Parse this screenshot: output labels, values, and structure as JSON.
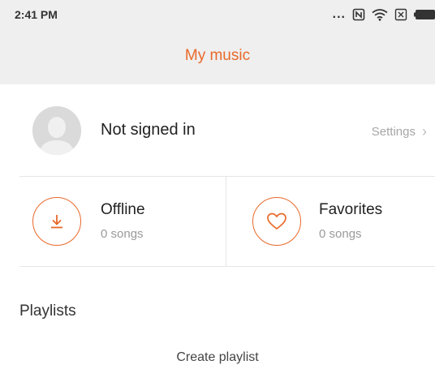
{
  "status_bar": {
    "time": "2:41 PM",
    "icons": [
      "more-dots-icon",
      "nfc-icon",
      "wifi-icon",
      "sim-icon",
      "battery-icon"
    ],
    "dots": "..."
  },
  "header": {
    "title": "My music"
  },
  "profile": {
    "status": "Not signed in",
    "settings_label": "Settings",
    "chevron": "›"
  },
  "tiles": [
    {
      "title": "Offline",
      "subtitle": "0 songs",
      "icon": "download-icon"
    },
    {
      "title": "Favorites",
      "subtitle": "0 songs",
      "icon": "heart-icon"
    }
  ],
  "playlists": {
    "section_title": "Playlists",
    "create_label": "Create playlist"
  },
  "colors": {
    "accent": "#e8692a",
    "header_bg": "#efefef",
    "muted_text": "#9a9a9a"
  }
}
